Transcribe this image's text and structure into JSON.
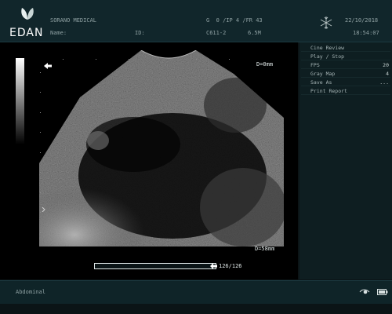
{
  "header": {
    "logo_text": "EDAN",
    "institution": "SORANO MEDICAL",
    "name_label": "Name:",
    "id_label": "ID:",
    "params": "G  0 /IP 4 /FR 43",
    "probe": "C611-2",
    "frequency": "6.5M",
    "date": "22/10/2018",
    "time": "18:54:07"
  },
  "image_area": {
    "depth_top": "D=0mm",
    "depth_bottom": "D=58mm",
    "cine_counter": "126/126",
    "cine_progress": 1.0
  },
  "menu": {
    "items": [
      {
        "label": "Cine Review",
        "value": ""
      },
      {
        "label": "Play / Stop",
        "value": ""
      },
      {
        "label": "FPS",
        "value": "20"
      },
      {
        "label": "Gray Map",
        "value": "4"
      },
      {
        "label": "Save As",
        "value": "..."
      },
      {
        "label": "Print Report",
        "value": ""
      }
    ]
  },
  "footer": {
    "mode": "Abdominal"
  }
}
